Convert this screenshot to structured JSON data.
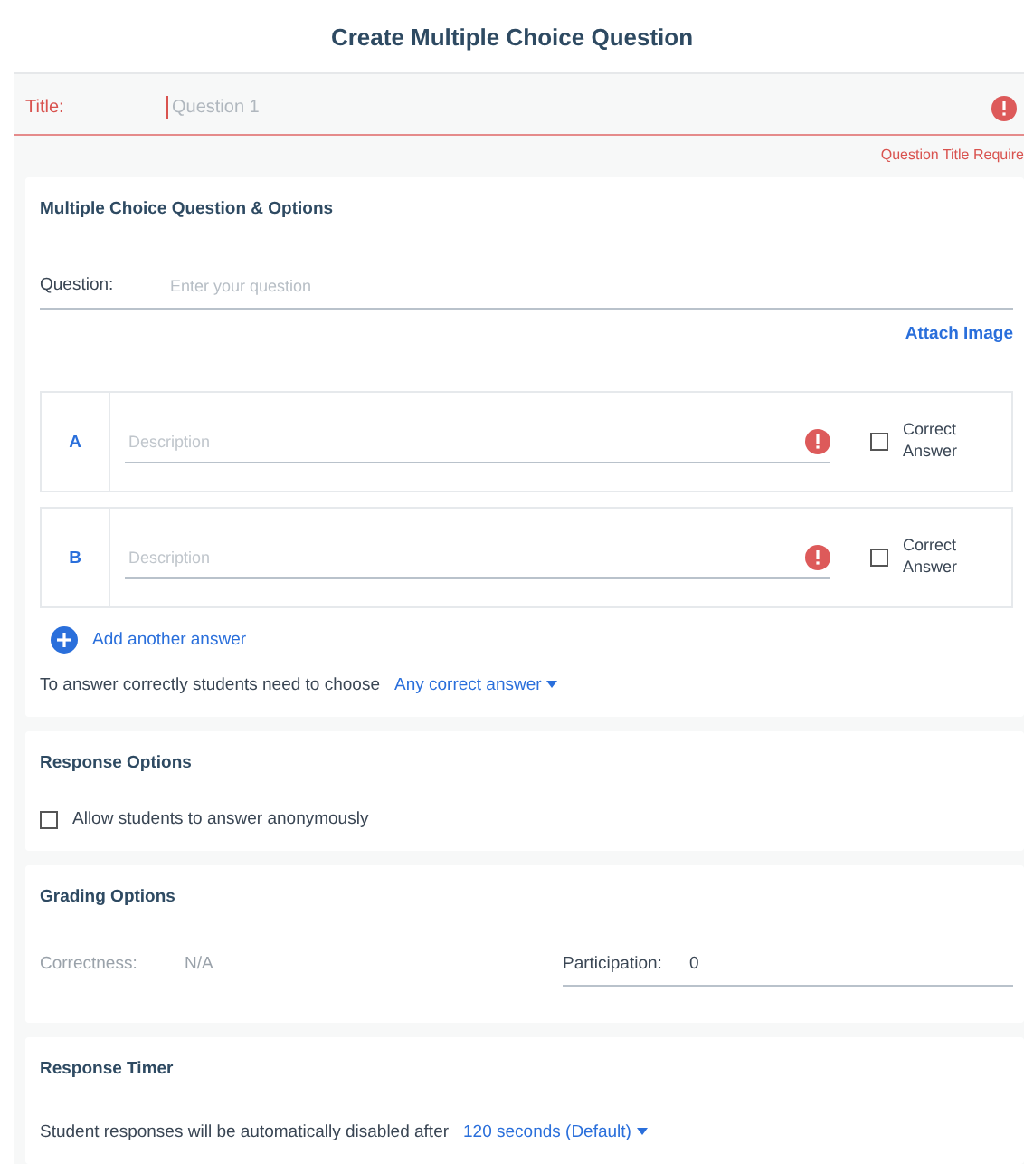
{
  "header": {
    "title": "Create Multiple Choice Question"
  },
  "title_field": {
    "label": "Title:",
    "placeholder": "Question 1",
    "error": true,
    "error_message": "Question Title Require"
  },
  "question_section": {
    "heading": "Multiple Choice Question & Options",
    "question_label": "Question:",
    "question_placeholder": "Enter your question",
    "attach_link": "Attach Image",
    "answers": [
      {
        "letter": "A",
        "placeholder": "Description",
        "error": true,
        "correct_label": "Correct Answer",
        "checked": false
      },
      {
        "letter": "B",
        "placeholder": "Description",
        "error": true,
        "correct_label": "Correct Answer",
        "checked": false
      }
    ],
    "add_answer": "Add another answer",
    "choose_text": "To answer correctly students need to choose",
    "choose_value": "Any correct answer"
  },
  "response_options": {
    "heading": "Response Options",
    "options": [
      {
        "label": "Allow students to answer anonymously",
        "checked": false
      }
    ]
  },
  "grading": {
    "heading": "Grading Options",
    "fields": [
      {
        "label": "Correctness:",
        "value": "N/A",
        "disabled": true
      },
      {
        "label": "Participation:",
        "value": "0",
        "disabled": false
      }
    ]
  },
  "timer": {
    "heading": "Response Timer",
    "text": "Student responses will be automatically disabled after",
    "value": "120 seconds (Default)"
  }
}
